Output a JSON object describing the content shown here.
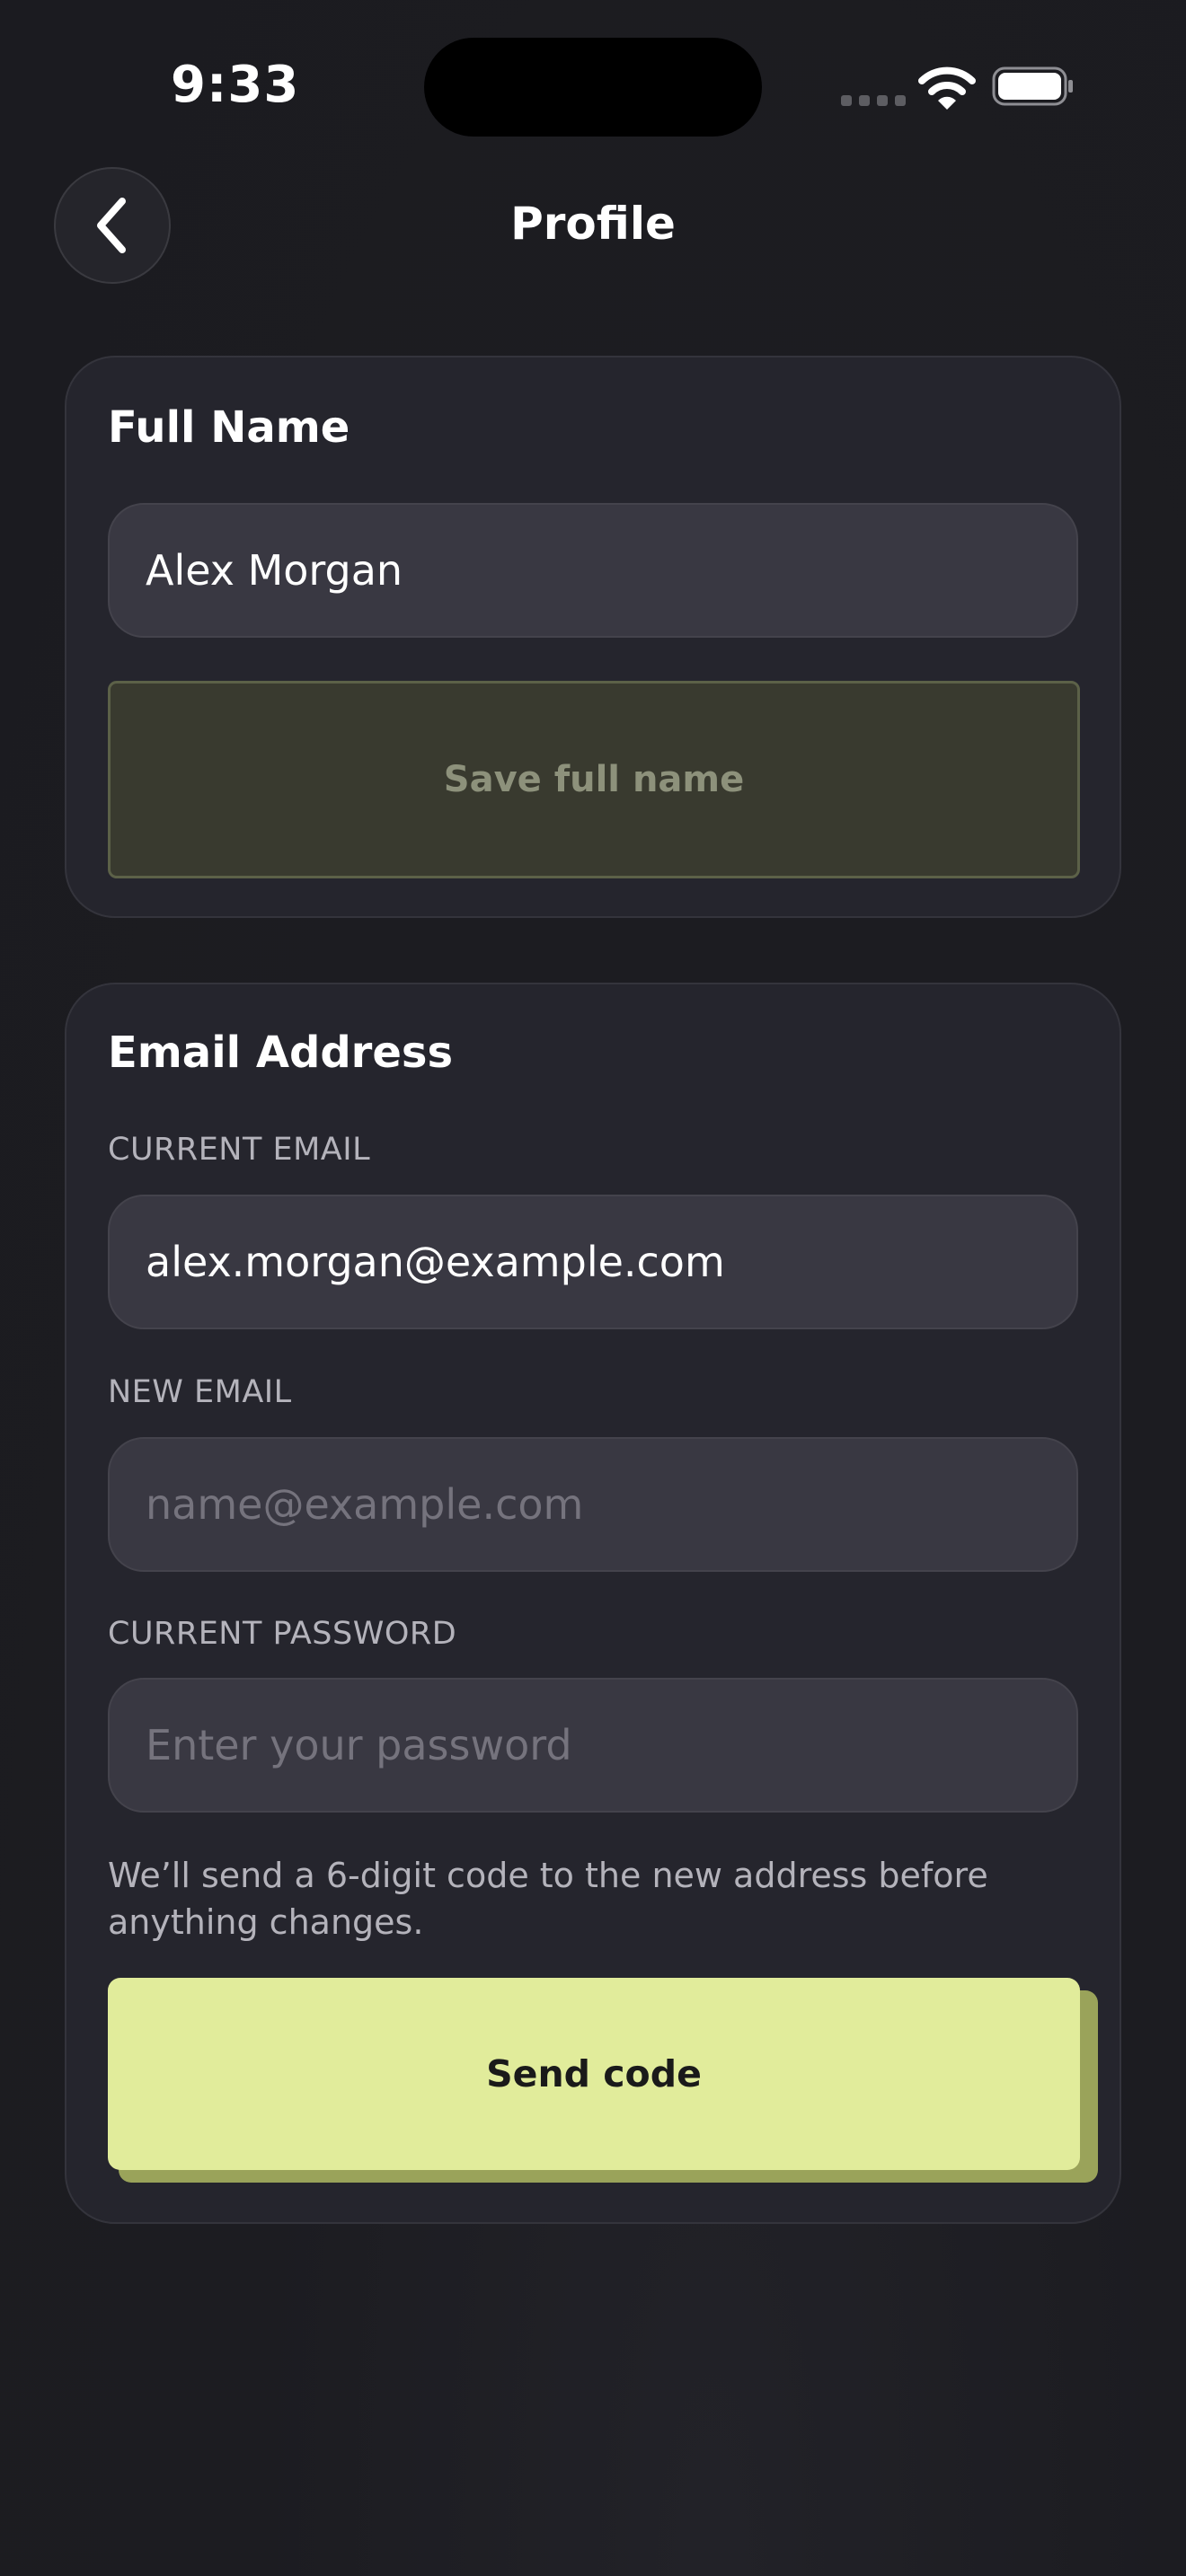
{
  "status_bar": {
    "time": "9:33",
    "icons": [
      "cellular-signal-icon",
      "wifi-icon",
      "battery-icon"
    ]
  },
  "header": {
    "title": "Profile",
    "back_icon": "chevron-left-icon"
  },
  "full_name_card": {
    "title": "Full Name",
    "name_value": "Alex Morgan",
    "save_label": "Save full name"
  },
  "email_card": {
    "title": "Email Address",
    "current_email_label": "CURRENT EMAIL",
    "current_email_value": "alex.morgan@example.com",
    "new_email_label": "NEW EMAIL",
    "new_email_placeholder": "name@example.com",
    "password_label": "CURRENT PASSWORD",
    "password_placeholder": "Enter your password",
    "helper_text": "We’ll send a 6-digit code to the new address before anything changes.",
    "send_label": "Send code"
  },
  "colors": {
    "background": "#1c1c21",
    "card": "#25252d",
    "input": "#393842",
    "accent": "#e1ec9b",
    "accent_shadow": "#9aa35a",
    "disabled_button": "#393a2f"
  }
}
